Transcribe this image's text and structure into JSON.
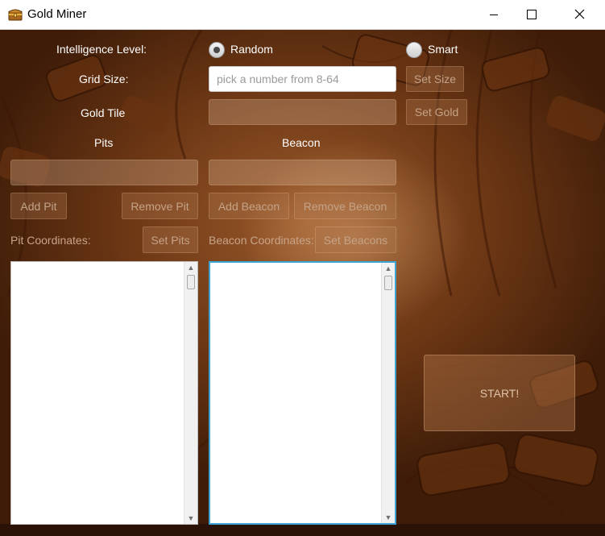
{
  "window": {
    "title": "Gold Miner",
    "icons": {
      "app": "treasure-chest-icon",
      "minimize": "minimize-icon",
      "maximize": "maximize-icon",
      "close": "close-icon"
    }
  },
  "intelligence": {
    "label": "Intelligence Level:",
    "options": [
      {
        "label": "Random",
        "selected": true
      },
      {
        "label": "Smart",
        "selected": false
      }
    ]
  },
  "grid_size": {
    "label": "Grid Size:",
    "value": "",
    "placeholder": "pick a number from 8-64",
    "button": "Set Size"
  },
  "gold_tile": {
    "label": "Gold Tile",
    "value": "",
    "button": "Set Gold"
  },
  "pits": {
    "header": "Pits",
    "value": "",
    "add_button": "Add Pit",
    "remove_button": "Remove Pit",
    "coordinates_label": "Pit Coordinates:",
    "set_button": "Set Pits",
    "items": []
  },
  "beacon": {
    "header": "Beacon",
    "value": "",
    "add_button": "Add Beacon",
    "remove_button": "Remove Beacon",
    "coordinates_label": "Beacon Coordinates:",
    "set_button": "Set Beacons",
    "items": []
  },
  "start_button": "START!",
  "colors": {
    "focus_border": "#3da3d3",
    "background_brown": "#6e3815",
    "field_white": "#ffffff"
  }
}
